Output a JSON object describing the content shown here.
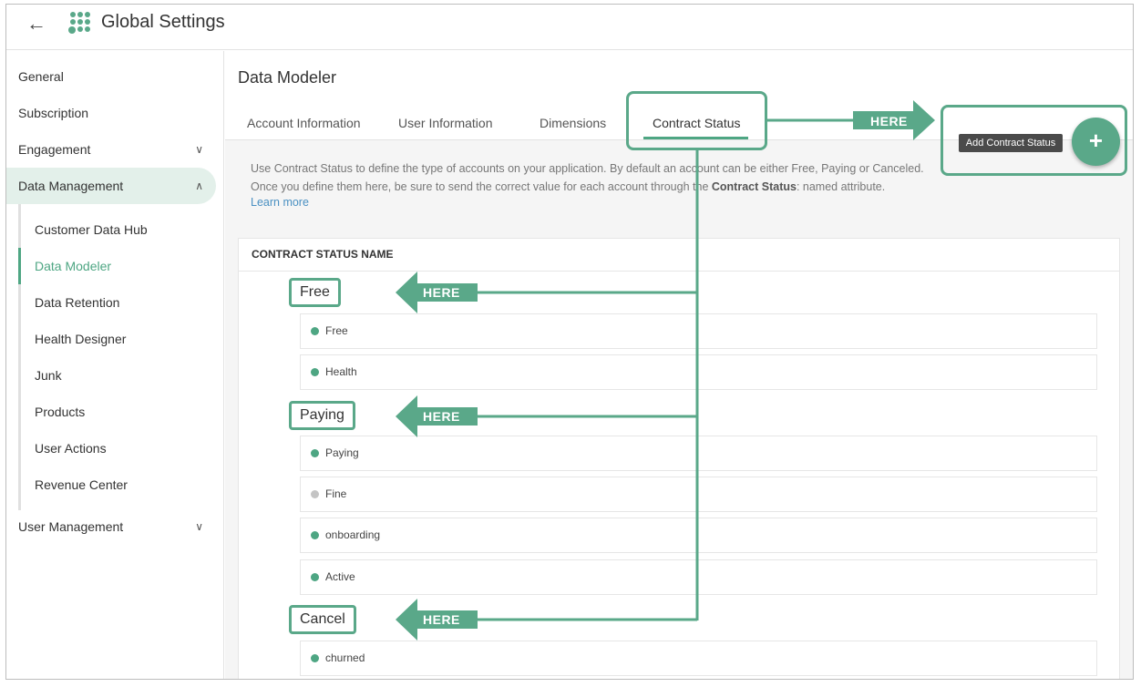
{
  "app": {
    "title": "Global Settings",
    "back_icon": "arrow-left-icon",
    "logo_icon": "dots-logo-icon"
  },
  "sidebar": {
    "items": [
      {
        "label": "General"
      },
      {
        "label": "Subscription"
      },
      {
        "label": "Engagement",
        "chevron": "chevron-down-icon"
      },
      {
        "label": "Data Management",
        "chevron": "chevron-up-icon",
        "expanded": true
      },
      {
        "label": "User Management",
        "chevron": "chevron-down-icon"
      }
    ],
    "sub_items": [
      {
        "label": "Customer Data Hub"
      },
      {
        "label": "Data Modeler",
        "active": true
      },
      {
        "label": "Data Retention"
      },
      {
        "label": "Health Designer"
      },
      {
        "label": "Junk"
      },
      {
        "label": "Products"
      },
      {
        "label": "User Actions"
      },
      {
        "label": "Revenue Center"
      }
    ]
  },
  "main": {
    "title": "Data Modeler",
    "tabs": [
      {
        "label": "Account Information"
      },
      {
        "label": "User Information"
      },
      {
        "label": "Dimensions"
      },
      {
        "label": "Contract Status",
        "active": true
      }
    ],
    "description": {
      "line1": "Use Contract Status to define the type of accounts on your application. By default an account can be either Free, Paying or Canceled.",
      "line2_pre": "Once you define them here, be sure to send the correct value for each account through the ",
      "line2_bold": "Contract Status",
      "line2_post": ": named attribute.",
      "learn_more": "Learn more"
    },
    "add_button": {
      "label": "+",
      "tooltip": "Add Contract Status"
    },
    "table": {
      "header": "CONTRACT STATUS NAME",
      "groups": [
        {
          "name": "Free",
          "statuses": [
            {
              "label": "Free",
              "color": "#4ea683"
            },
            {
              "label": "Health",
              "color": "#4ea683"
            }
          ]
        },
        {
          "name": "Paying",
          "statuses": [
            {
              "label": "Paying",
              "color": "#4ea683"
            },
            {
              "label": "Fine",
              "color": "#c4c4c4"
            },
            {
              "label": "onboarding",
              "color": "#4ea683"
            },
            {
              "label": "Active",
              "color": "#4ea683"
            }
          ]
        },
        {
          "name": "Cancel",
          "statuses": [
            {
              "label": "churned",
              "color": "#4ea683"
            }
          ]
        }
      ]
    }
  },
  "annotations": {
    "here": "HERE",
    "accent": "#5aa889"
  }
}
